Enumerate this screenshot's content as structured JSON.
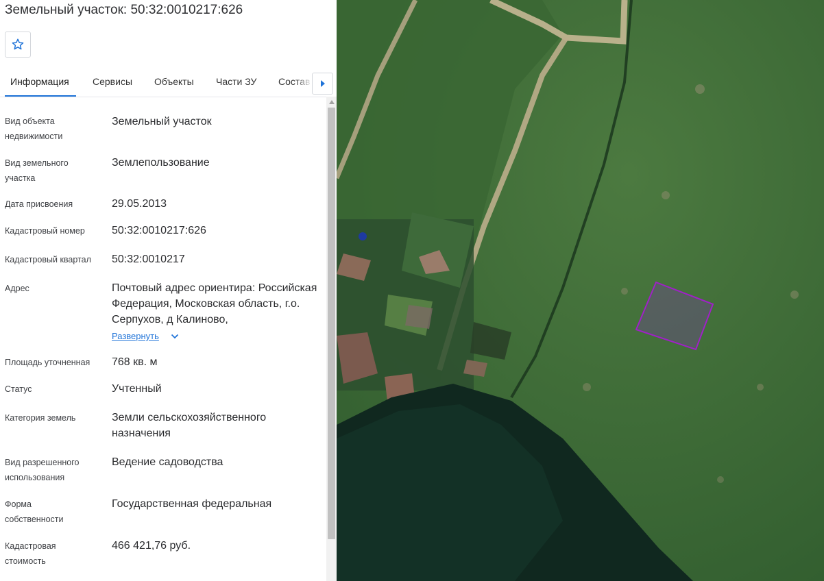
{
  "header": {
    "title": "Земельный участок: 50:32:0010217:626"
  },
  "tabs": [
    {
      "label": "Информация",
      "active": true
    },
    {
      "label": "Сервисы",
      "active": false
    },
    {
      "label": "Объекты",
      "active": false
    },
    {
      "label": "Части ЗУ",
      "active": false
    },
    {
      "label": "Состав",
      "active": false
    }
  ],
  "details": {
    "object_type": {
      "label": "Вид объекта недвижимости",
      "value": "Земельный участок"
    },
    "parcel_type": {
      "label": "Вид земельного участка",
      "value": "Землепользование"
    },
    "assign_date": {
      "label": "Дата присвоения",
      "value": "29.05.2013"
    },
    "cadastral_number": {
      "label": "Кадастровый номер",
      "value": "50:32:0010217:626"
    },
    "cadastral_quarter": {
      "label": "Кадастровый квартал",
      "value": "50:32:0010217"
    },
    "address": {
      "label": "Адрес",
      "value": "Почтовый адрес ориентира: Российская Федерация, Московская область, г.о. Серпухов, д Калиново,",
      "expand_label": "Развернуть"
    },
    "area": {
      "label": "Площадь уточненная",
      "value": "768 кв. м"
    },
    "status": {
      "label": "Статус",
      "value": "Учтенный"
    },
    "land_category": {
      "label": "Категория земель",
      "value": "Земли сельскохозяйственного назначения"
    },
    "permitted_use": {
      "label": "Вид разрешенного использования",
      "value": "Ведение садоводства"
    },
    "ownership": {
      "label": "Форма собственности",
      "value": "Государственная федеральная"
    },
    "cadastral_value": {
      "label": "Кадастровая стоимость",
      "value": "466 421,76 руб."
    }
  },
  "icons": {
    "favorite": "star-outline-icon",
    "tab_next": "triangle-right-icon",
    "expand": "chevron-down-icon",
    "scroll_up": "triangle-up-icon"
  },
  "colors": {
    "accent": "#1f73d8",
    "parcel_outline": "#a020c8",
    "map_grass": "#3b6a35",
    "map_forest": "#0f2a22"
  }
}
